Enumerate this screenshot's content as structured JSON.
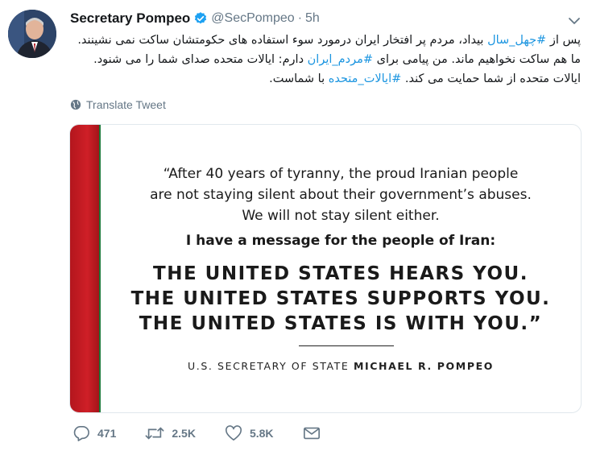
{
  "author": {
    "name": "Secretary Pompeo",
    "handle": "@SecPompeo",
    "separator": "·",
    "time": "5h",
    "avatar_icon": "avatar-portrait",
    "verified_icon": "verified-badge-icon"
  },
  "tweet": {
    "p1": "پس از ",
    "tag1": "#چهل_سال",
    "p2": " بیداد، مردم پر افتخار ایران درمورد سوء استفاده های حکومتشان ساکت نمی نشینند. ما هم ساکت نخواهیم ماند. من پیامی برای ",
    "tag2": "#مردم_ایران",
    "p3": " دارم: ایالات متحده صدای شما را می شنود. ایالات متحده از شما حمایت می کند. ",
    "tag3": "#ایالات_متحده",
    "p4": " با شماست."
  },
  "translate_label": "Translate Tweet",
  "card": {
    "quote_lines": [
      "“After 40 years of tyranny, the proud Iranian people",
      "are not staying silent about their government’s abuses.",
      "We will not stay silent either."
    ],
    "message": "I have a message for the people of Iran:",
    "big_lines": [
      "THE UNITED STATES HEARS YOU.",
      "THE UNITED STATES SUPPORTS YOU.",
      "THE UNITED STATES IS WITH YOU.”"
    ],
    "signature_prefix": "U.S. SECRETARY OF STATE ",
    "signature_name": "MICHAEL R. POMPEO",
    "colors": {
      "stripe_red": "#cf1f27",
      "stripe_green": "#1e7a3c"
    }
  },
  "actions": {
    "replies": "471",
    "retweets": "2.5K",
    "likes": "5.8K"
  },
  "colors": {
    "link": "#1b95e0",
    "muted": "#657786",
    "verified": "#1da1f2"
  }
}
